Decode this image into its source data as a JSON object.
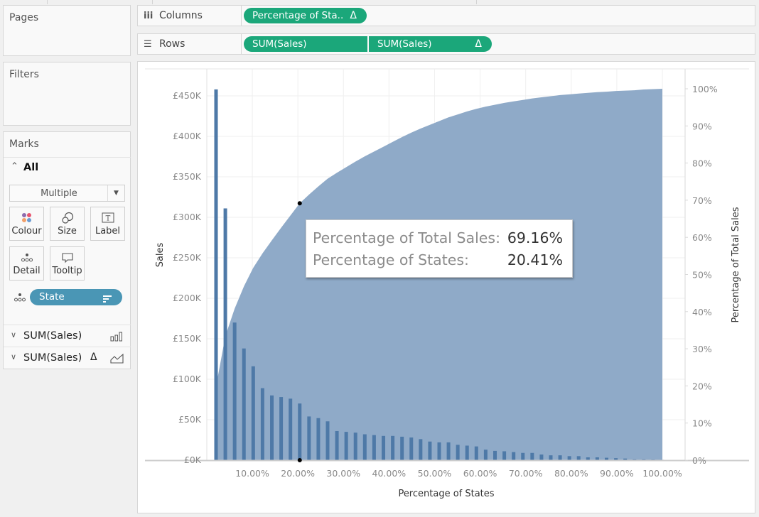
{
  "panels": {
    "pages_title": "Pages",
    "filters_title": "Filters",
    "marks_title": "Marks"
  },
  "shelves": {
    "columns": {
      "label": "Columns",
      "icon": "columns-icon",
      "pills": [
        {
          "label": "Percentage of Sta..",
          "delta": "Δ"
        }
      ]
    },
    "rows": {
      "label": "Rows",
      "icon": "rows-icon",
      "pills": [
        {
          "label": "SUM(Sales)"
        },
        {
          "label": "SUM(Sales)",
          "delta": "Δ"
        }
      ]
    }
  },
  "marks": {
    "all_label": "All",
    "mark_type": "Multiple",
    "cards": [
      {
        "label": "Colour",
        "icon": "colour-icon"
      },
      {
        "label": "Size",
        "icon": "size-icon"
      },
      {
        "label": "Label",
        "icon": "label-icon"
      },
      {
        "label": "Detail",
        "icon": "detail-icon"
      },
      {
        "label": "Tooltip",
        "icon": "tooltip-icon"
      }
    ],
    "detail_pill": "State",
    "measures": [
      {
        "label": "SUM(Sales)",
        "icon": "bar-chart-icon",
        "delta": ""
      },
      {
        "label": "SUM(Sales)",
        "icon": "area-chart-icon",
        "delta": "Δ"
      }
    ]
  },
  "colors": {
    "pill_green": "#1ba77a",
    "pill_blue": "#4a96b5",
    "bar": "#4e79a7",
    "area": "#8faac8"
  },
  "tooltip": {
    "rows": [
      {
        "label": "Percentage of Total Sales:",
        "value": "69.16%"
      },
      {
        "label": "Percentage of States:",
        "value": "20.41%"
      }
    ]
  },
  "chart_data": {
    "type": "bar",
    "title": "",
    "xlabel": "Percentage of States",
    "ylabel": "Sales",
    "y2label": "Percentage of Total Sales",
    "x_ticks": [
      "10.00%",
      "20.00%",
      "30.00%",
      "40.00%",
      "50.00%",
      "60.00%",
      "70.00%",
      "80.00%",
      "90.00%",
      "100.00%"
    ],
    "y_ticks": [
      "£0K",
      "£50K",
      "£100K",
      "£150K",
      "£200K",
      "£250K",
      "£300K",
      "£350K",
      "£400K",
      "£450K"
    ],
    "y2_ticks": [
      "0%",
      "10%",
      "20%",
      "30%",
      "40%",
      "50%",
      "60%",
      "70%",
      "80%",
      "90%",
      "100%"
    ],
    "xlim": [
      0,
      104
    ],
    "ylim": [
      0,
      478
    ],
    "y2lim": [
      0,
      104.5
    ],
    "grid": true,
    "n_states": 49,
    "series": [
      {
        "name": "SUM(Sales)",
        "type": "bar",
        "unit": "£K",
        "values": [
          458,
          311,
          170,
          138,
          116,
          89,
          80,
          78,
          76,
          70,
          54,
          52,
          48,
          36,
          35,
          34,
          32,
          31,
          30,
          30,
          29,
          28,
          26,
          23,
          22,
          22,
          19,
          18,
          17,
          13,
          11.5,
          11,
          10,
          9,
          9,
          7,
          6,
          6,
          5,
          5,
          3.5,
          3.5,
          3,
          2.5,
          2,
          1,
          1,
          0.8,
          0.5
        ]
      },
      {
        "name": "Percentage of Total Sales (running)",
        "type": "area",
        "unit": "%",
        "x": [
          2.04,
          4.08,
          6.12,
          8.16,
          10.2,
          12.24,
          14.29,
          16.33,
          18.37,
          20.41,
          22.45,
          24.49,
          26.53,
          28.57,
          30.61,
          32.65,
          34.69,
          36.73,
          38.78,
          40.82,
          42.86,
          44.9,
          46.94,
          48.98,
          51.02,
          53.06,
          55.1,
          57.14,
          59.18,
          61.22,
          63.27,
          65.31,
          67.35,
          69.39,
          71.43,
          73.47,
          75.51,
          77.55,
          79.59,
          81.63,
          83.67,
          85.71,
          87.76,
          89.8,
          91.84,
          93.88,
          95.92,
          97.96,
          100
        ],
        "values": [
          19.9,
          33.4,
          40.8,
          46.8,
          51.8,
          55.7,
          59.2,
          62.6,
          65.9,
          69.16,
          71.5,
          73.7,
          75.8,
          77.4,
          78.9,
          80.4,
          81.8,
          83.1,
          84.4,
          85.7,
          87.0,
          88.2,
          89.3,
          90.3,
          91.3,
          92.3,
          93.1,
          93.9,
          94.6,
          95.2,
          95.7,
          96.2,
          96.6,
          97.0,
          97.4,
          97.7,
          98.0,
          98.3,
          98.5,
          98.7,
          98.9,
          99.1,
          99.2,
          99.4,
          99.5,
          99.6,
          99.8,
          99.9,
          100
        ]
      }
    ],
    "highlight": {
      "x": 20.41,
      "y_percent": 69.16
    }
  }
}
